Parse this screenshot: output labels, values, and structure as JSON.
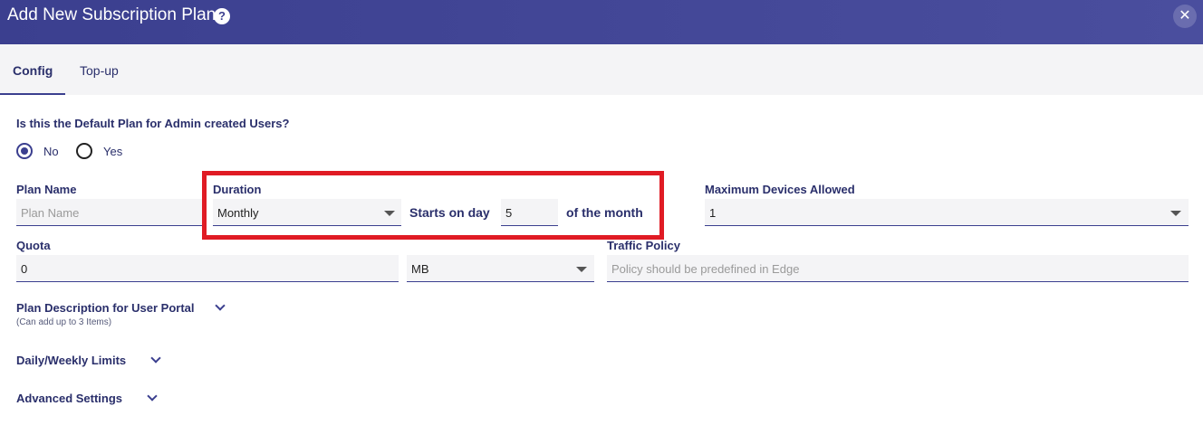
{
  "dialog": {
    "title": "Add New Subscription Plan",
    "help_icon": "?",
    "close_icon": "✕"
  },
  "tabs": [
    {
      "label": "Config",
      "active": true
    },
    {
      "label": "Top-up",
      "active": false
    }
  ],
  "default_plan": {
    "question": "Is this the Default Plan for Admin created Users?",
    "options": [
      {
        "label": "No",
        "selected": true
      },
      {
        "label": "Yes",
        "selected": false
      }
    ]
  },
  "plan_name": {
    "label": "Plan Name",
    "placeholder": "Plan Name",
    "value": ""
  },
  "duration": {
    "label": "Duration",
    "value": "Monthly",
    "starts_on_label": "Starts on day",
    "start_day": "5",
    "suffix": "of the month"
  },
  "max_devices": {
    "label": "Maximum Devices Allowed",
    "value": "1"
  },
  "quota": {
    "label": "Quota",
    "value": "0",
    "unit": "MB"
  },
  "traffic_policy": {
    "label": "Traffic Policy",
    "placeholder": "Policy should be predefined in Edge"
  },
  "sections": {
    "plan_description": {
      "label": "Plan Description for User Portal",
      "note": "(Can add up to 3 Items)"
    },
    "limits": {
      "label": "Daily/Weekly Limits"
    },
    "advanced": {
      "label": "Advanced Settings"
    }
  },
  "colors": {
    "header": "#3b3f8f",
    "accent": "#2a2f6b",
    "highlight": "#e01b24",
    "field_bg": "#f4f4f6"
  }
}
